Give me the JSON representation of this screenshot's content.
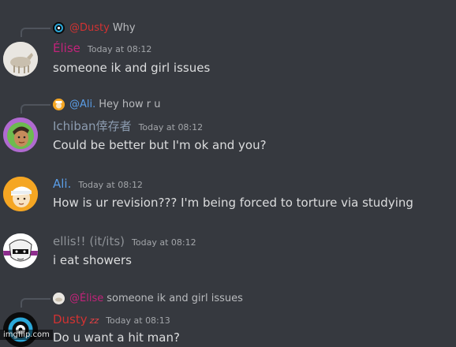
{
  "colors": {
    "background": "#36393f",
    "dusty": "#d23232",
    "elise": "#c2237a",
    "ali": "#5a9de6",
    "ichiban": "#8c9cb0",
    "ellis": "#8e9297",
    "text": "#dcddde",
    "muted": "#a3a6aa"
  },
  "messages": [
    {
      "reply": {
        "mention": "@Dusty",
        "text": "Why",
        "avatar_icon": "dusty-avatar-mini-icon"
      },
      "author": "Élise",
      "timestamp": "Today at 08:12",
      "content": "someone ik and girl issues",
      "avatar_icon": "horse-avatar-icon"
    },
    {
      "reply": {
        "mention": "@Ali.",
        "text": "Hey how r u",
        "avatar_icon": "ali-avatar-mini-icon"
      },
      "author": "Ichiban倖存者",
      "timestamp": "Today at 08:12",
      "content": "Could be better but I'm ok and you?",
      "avatar_icon": "anime-character-avatar-icon"
    },
    {
      "author": "Ali.",
      "timestamp": "Today at 08:12",
      "content": "How is ur revision??? I'm being forced to torture via studying",
      "avatar_icon": "character-avatar-icon"
    },
    {
      "author": "ellis!! (it/its)",
      "timestamp": "Today at 08:12",
      "content": "i eat showers",
      "avatar_icon": "drawn-character-avatar-icon"
    },
    {
      "reply": {
        "mention": "@Élise",
        "text": "someone ik and girl issues",
        "avatar_icon": "horse-avatar-mini-icon"
      },
      "author": "Dusty",
      "badge": "zz",
      "timestamp": "Today at 08:13",
      "content": "Do u want a hit man?",
      "avatar_icon": "dusty-avatar-icon"
    }
  ],
  "watermark": "imgflip.com"
}
